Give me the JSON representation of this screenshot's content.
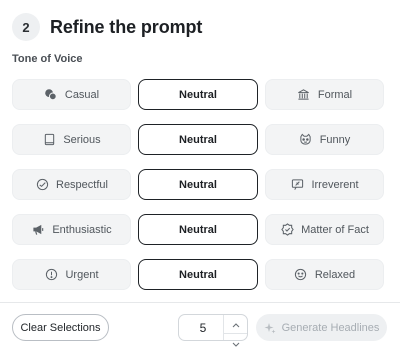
{
  "header": {
    "step": "2",
    "title": "Refine the prompt"
  },
  "section_label": "Tone of Voice",
  "rows": [
    {
      "left": {
        "label": "Casual",
        "icon": "chat-bubbles-icon"
      },
      "center": "Neutral",
      "right": {
        "label": "Formal",
        "icon": "institution-icon"
      }
    },
    {
      "left": {
        "label": "Serious",
        "icon": "book-icon"
      },
      "center": "Neutral",
      "right": {
        "label": "Funny",
        "icon": "cat-icon"
      }
    },
    {
      "left": {
        "label": "Respectful",
        "icon": "palette-icon"
      },
      "center": "Neutral",
      "right": {
        "label": "Irreverent",
        "icon": "irreverent-icon"
      }
    },
    {
      "left": {
        "label": "Enthusiastic",
        "icon": "megaphone-icon"
      },
      "center": "Neutral",
      "right": {
        "label": "Matter of Fact",
        "icon": "badge-check-icon"
      }
    },
    {
      "left": {
        "label": "Urgent",
        "icon": "alert-circle-icon"
      },
      "center": "Neutral",
      "right": {
        "label": "Relaxed",
        "icon": "smile-icon"
      }
    }
  ],
  "footer": {
    "clear_label": "Clear Selections",
    "count_value": "5",
    "generate_label": "Generate Headlines"
  }
}
